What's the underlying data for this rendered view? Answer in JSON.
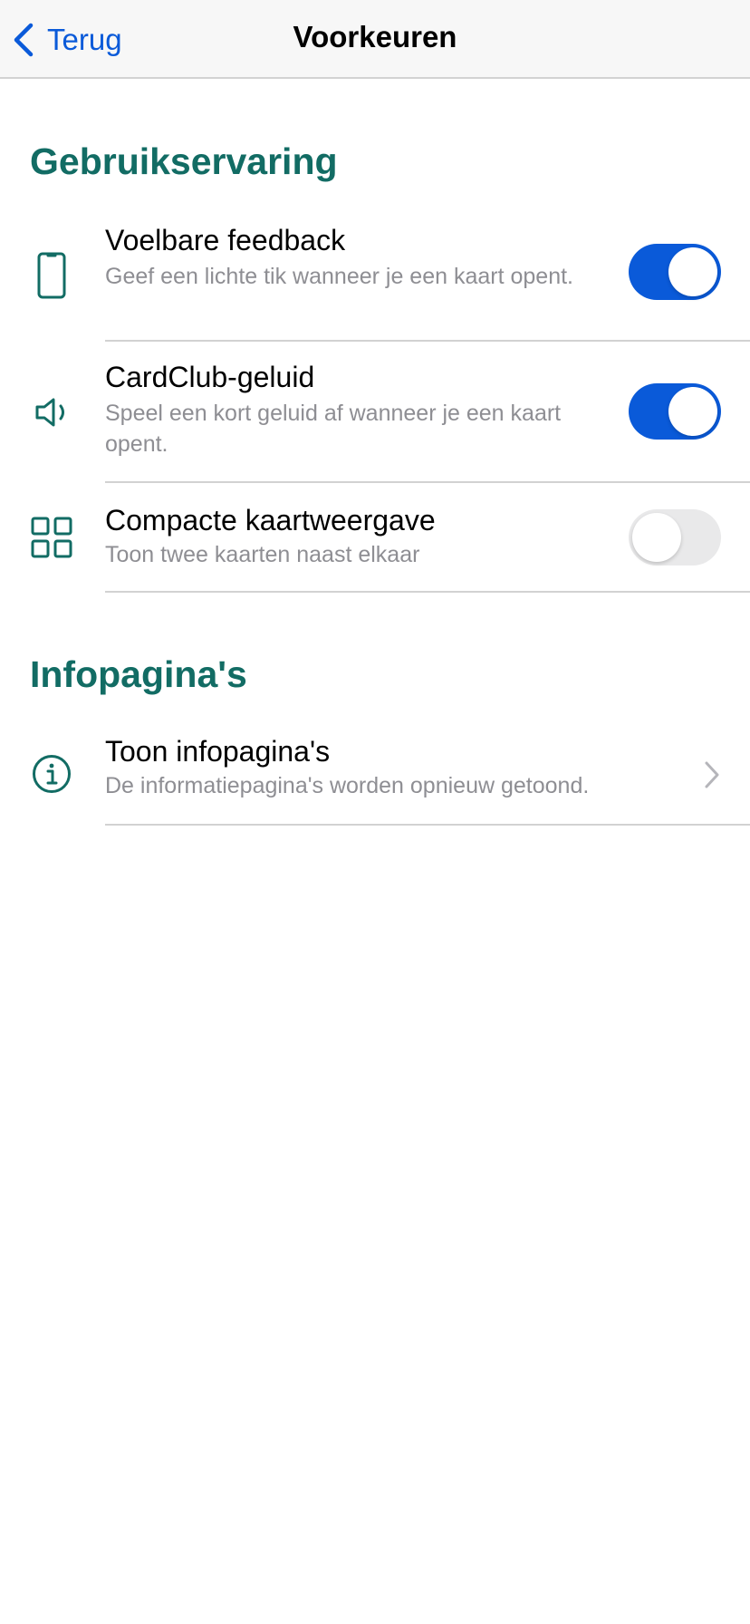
{
  "nav": {
    "back_label": "Terug",
    "title": "Voorkeuren"
  },
  "sections": [
    {
      "header": "Gebruikservaring",
      "items": [
        {
          "icon": "phone-icon",
          "title": "Voelbare feedback",
          "subtitle": "Geef een lichte tik wanneer je een kaart opent.",
          "toggle": true
        },
        {
          "icon": "speaker-icon",
          "title": "CardClub-geluid",
          "subtitle": "Speel een kort geluid af wanneer je een kaart opent.",
          "toggle": true
        },
        {
          "icon": "grid-icon",
          "title": "Compacte kaartweergave",
          "subtitle": "Toon twee kaarten naast elkaar",
          "toggle": false
        }
      ]
    },
    {
      "header": "Infopagina's",
      "items": [
        {
          "icon": "info-icon",
          "title": "Toon infopagina's",
          "subtitle": "De informatiepagina's worden opnieuw getoond."
        }
      ]
    }
  ],
  "colors": {
    "accent": "#0a5ad9",
    "section_header": "#126c64",
    "subtitle": "#8e8e93",
    "divider": "#d2d2d2"
  }
}
